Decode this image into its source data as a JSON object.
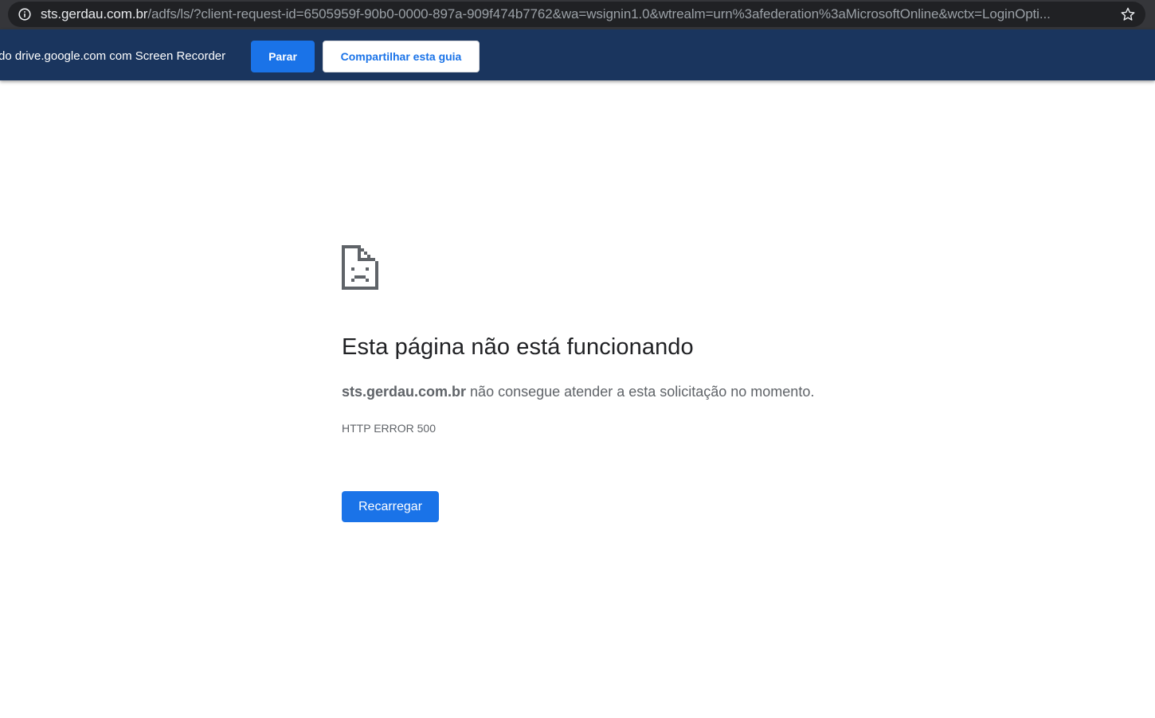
{
  "browser": {
    "url_host": "sts.gerdau.com.br",
    "url_path": "/adfs/ls/?client-request-id=6505959f-90b0-0000-897a-909f474b7762&wa=wsignin1.0&wtrealm=urn%3afederation%3aMicrosoftOnline&wctx=LoginOpti...",
    "info_icon": "info-icon",
    "bookmark_icon": "star-icon"
  },
  "banner": {
    "text": "do drive.google.com com Screen Recorder",
    "stop_label": "Parar",
    "share_label": "Compartilhar esta guia"
  },
  "error": {
    "icon": "sad-page-icon",
    "title": "Esta página não está funcionando",
    "host": "sts.gerdau.com.br",
    "message": " não consegue atender a esta solicitação no momento.",
    "code": "HTTP ERROR 500",
    "reload_label": "Recarregar"
  },
  "colors": {
    "banner_bg": "#1a355e",
    "accent": "#1a73e8",
    "toolbar_bg": "#35363a"
  }
}
